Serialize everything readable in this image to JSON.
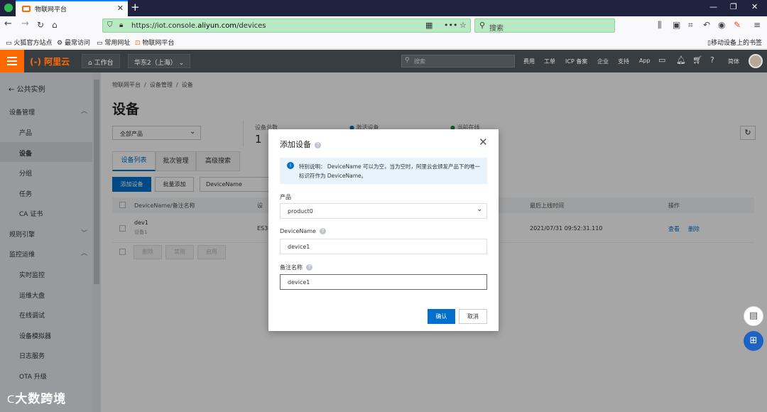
{
  "browser": {
    "tab_title": "物联网平台",
    "url_prefix": "https://iot.console.",
    "url_domain": "aliyun.com",
    "url_path": "/devices",
    "search_placeholder": "搜索",
    "bookmarks": [
      "火狐官方站点",
      "最常访问",
      "常用网址",
      "物联网平台"
    ],
    "mobile_bookmarks": "移动设备上的书签"
  },
  "header": {
    "logo": "(-) 阿里云",
    "workbench": "工作台",
    "region": "华东2（上海）",
    "search_placeholder": "搜索",
    "links": [
      "费用",
      "工单",
      "ICP 备案",
      "企业",
      "支持",
      "App"
    ],
    "lang": "简体"
  },
  "sidebar": {
    "back": "公共实例",
    "groups": [
      {
        "label": "设备管理",
        "items": [
          "产品",
          "设备",
          "分组",
          "任务",
          "CA 证书"
        ]
      },
      {
        "label": "规则引擎"
      },
      {
        "label": "监控运维",
        "items": [
          "实时监控",
          "运维大盘",
          "在线调试",
          "设备模拟器",
          "日志服务",
          "OTA 升级"
        ]
      }
    ]
  },
  "main": {
    "breadcrumb": [
      "物联网平台",
      "设备管理",
      "设备"
    ],
    "title": "设备",
    "product_filter": "全部产品",
    "stats": [
      {
        "label": "设备总数",
        "value": "1"
      },
      {
        "label": "激活设备",
        "value": ""
      },
      {
        "label": "当前在线",
        "value": ""
      }
    ],
    "tabs": [
      "设备列表",
      "批次管理",
      "高级搜索"
    ],
    "add_button": "添加设备",
    "batch_add_button": "批量添加",
    "search_field": "DeviceName",
    "table": {
      "headers": [
        "DeviceName/备注名称",
        "设",
        "最后上线时间",
        "操作"
      ],
      "rows": [
        {
          "name": "dev1",
          "alias": "设备1",
          "type": "ES3",
          "last_online": "2021/07/31 09:52:31.110",
          "view": "查看",
          "delete": "删除"
        }
      ],
      "bulk_actions": [
        "删除",
        "禁用",
        "启用"
      ]
    }
  },
  "modal": {
    "title": "添加设备",
    "notice": "特别说明： DeviceName 可以为空，当为空时，阿里云会颁发产品下的唯一标识符作为 DeviceName。",
    "product_label": "产品",
    "product_value": "product0",
    "devicename_label": "DeviceName",
    "devicename_value": "device1",
    "alias_label": "备注名称",
    "alias_value": "device1",
    "confirm": "确认",
    "cancel": "取消"
  },
  "watermark": "大数跨境"
}
